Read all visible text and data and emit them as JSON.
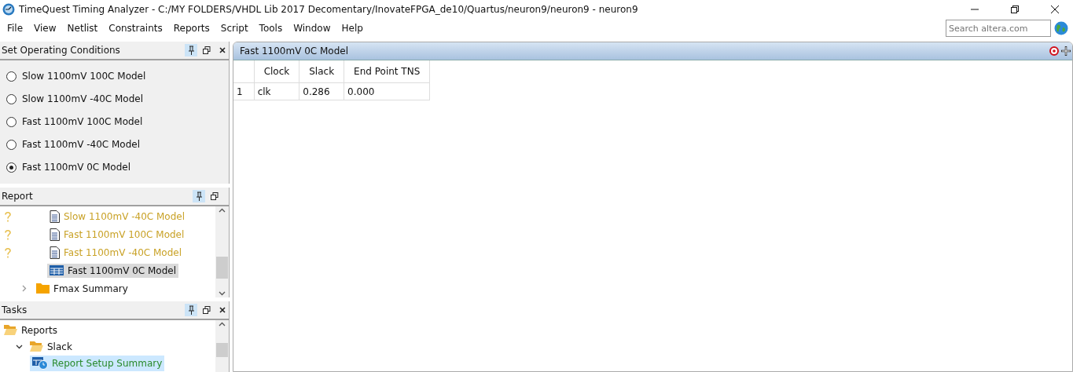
{
  "window": {
    "title": "TimeQuest Timing Analyzer - C:/MY FOLDERS/VHDL Lib 2017 Decomentary/InovateFPGA_de10/Quartus/neuron9/neuron9 - neuron9"
  },
  "menu": [
    "File",
    "View",
    "Netlist",
    "Constraints",
    "Reports",
    "Script",
    "Tools",
    "Window",
    "Help"
  ],
  "search": {
    "placeholder": "Search altera.com"
  },
  "conditions": {
    "title": "Set Operating Conditions",
    "pinned": true,
    "options": [
      {
        "label": "Slow 1100mV 100C Model",
        "selected": false
      },
      {
        "label": "Slow 1100mV -40C Model",
        "selected": false
      },
      {
        "label": "Fast 1100mV 100C Model",
        "selected": false
      },
      {
        "label": "Fast 1100mV -40C Model",
        "selected": false
      },
      {
        "label": "Fast 1100mV 0C Model",
        "selected": true
      }
    ]
  },
  "report": {
    "title": "Report",
    "pinned": true,
    "items": [
      {
        "kind": "doc",
        "label": "Slow 1100mV -40C Model",
        "outdated": true,
        "selected": false
      },
      {
        "kind": "doc",
        "label": "Fast 1100mV 100C Model",
        "outdated": true,
        "selected": false
      },
      {
        "kind": "doc",
        "label": "Fast 1100mV -40C Model",
        "outdated": true,
        "selected": false
      },
      {
        "kind": "table",
        "label": "Fast 1100mV 0C Model",
        "outdated": false,
        "selected": true
      },
      {
        "kind": "folder",
        "label": "Fmax Summary",
        "outdated": false,
        "selected": false,
        "expanded": false
      }
    ]
  },
  "tasks": {
    "title": "Tasks",
    "pinned": true,
    "items": [
      {
        "label": "Reports",
        "expanded": true,
        "selected": false,
        "children": [
          {
            "label": "Slack",
            "expanded": true,
            "selected": false,
            "children": [
              {
                "label": "Report Setup Summary",
                "selected": true
              }
            ]
          }
        ]
      }
    ]
  },
  "view": {
    "title": "Fast 1100mV 0C Model",
    "table": {
      "columns": [
        "Clock",
        "Slack",
        "End Point TNS"
      ],
      "rows": [
        {
          "index": "1",
          "cells": [
            "clk",
            "0.286",
            "0.000"
          ]
        }
      ]
    }
  }
}
